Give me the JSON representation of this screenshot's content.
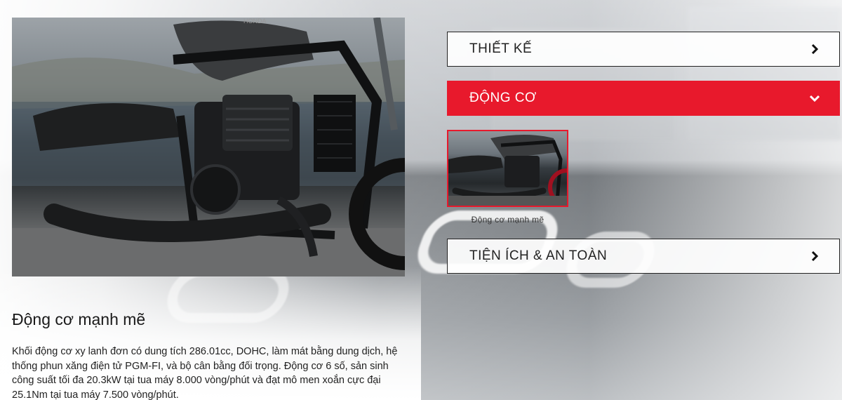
{
  "accordion": [
    {
      "label": "THIẾT KẾ",
      "state": "collapsed",
      "icon": "chevron-right-icon"
    },
    {
      "label": "ĐỘNG CƠ",
      "state": "expanded",
      "icon": "chevron-down-icon"
    },
    {
      "label": "TIỆN ÍCH & AN TOÀN",
      "state": "collapsed",
      "icon": "chevron-right-icon"
    }
  ],
  "gallery": {
    "items": [
      {
        "caption": "Động cơ mạnh mẽ",
        "selected": true
      }
    ]
  },
  "feature": {
    "title": "Động cơ mạnh mẽ",
    "description": "Khối động cơ xy lanh đơn có dung tích 286.01cc, DOHC, làm mát bằng dung dịch, hệ thống phun xăng điện tử PGM-FI, và bộ cân bằng đối trọng. Động cơ 6 số, sản sinh công suất tối đa 20.3kW tại tua máy 8.000 vòng/phút và đạt mô men xoắn cực đại 25.1Nm tại tua máy 7.500 vòng/phút."
  },
  "hero_image": {
    "badge_text": "HONDA"
  },
  "colors": {
    "accent": "#e8192c",
    "text": "#222222",
    "border": "#222222"
  }
}
